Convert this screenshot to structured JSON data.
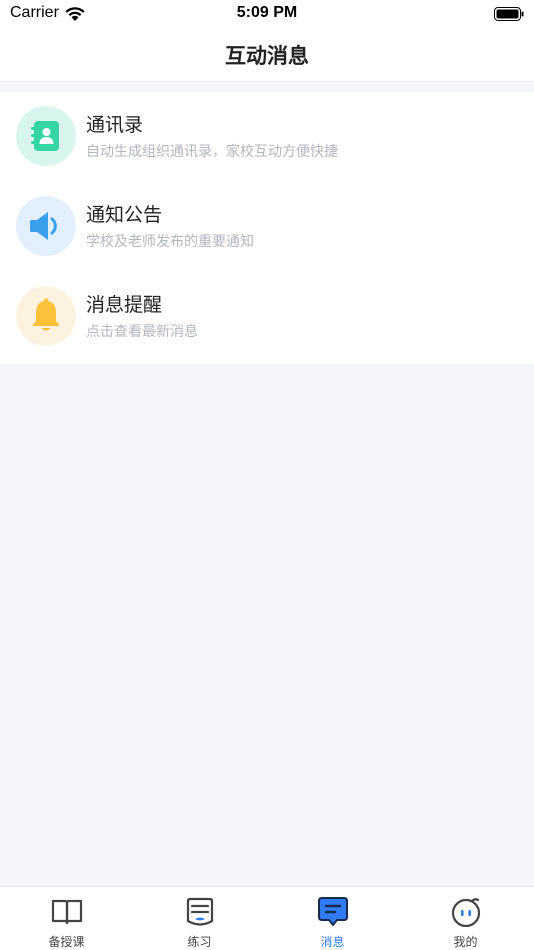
{
  "status_bar": {
    "carrier": "Carrier",
    "time": "5:09 PM",
    "wifi_icon": "wifi-icon",
    "battery_icon": "battery-icon"
  },
  "nav": {
    "title": "互动消息"
  },
  "list": {
    "items": [
      {
        "title": "通讯录",
        "subtitle": "自动生成组织通讯录，家校互动方便快捷",
        "icon": "contacts-book-icon",
        "bg_color": "#d9f6ee",
        "icon_color": "#33d6a3"
      },
      {
        "title": "通知公告",
        "subtitle": "学校及老师发布的重要通知",
        "icon": "speaker-icon",
        "bg_color": "#e2f0fd",
        "icon_color": "#3aa0ee"
      },
      {
        "title": "消息提醒",
        "subtitle": "点击查看最新消息",
        "icon": "bell-icon",
        "bg_color": "#fdf2df",
        "icon_color": "#fbc13a"
      }
    ]
  },
  "tab_bar": {
    "active_color": "#2f7cf6",
    "tabs": [
      {
        "label": "备授课",
        "icon": "open-book-icon",
        "active": false
      },
      {
        "label": "练习",
        "icon": "practice-icon",
        "active": false
      },
      {
        "label": "消息",
        "icon": "message-icon",
        "active": true
      },
      {
        "label": "我的",
        "icon": "face-icon",
        "active": false
      }
    ]
  }
}
